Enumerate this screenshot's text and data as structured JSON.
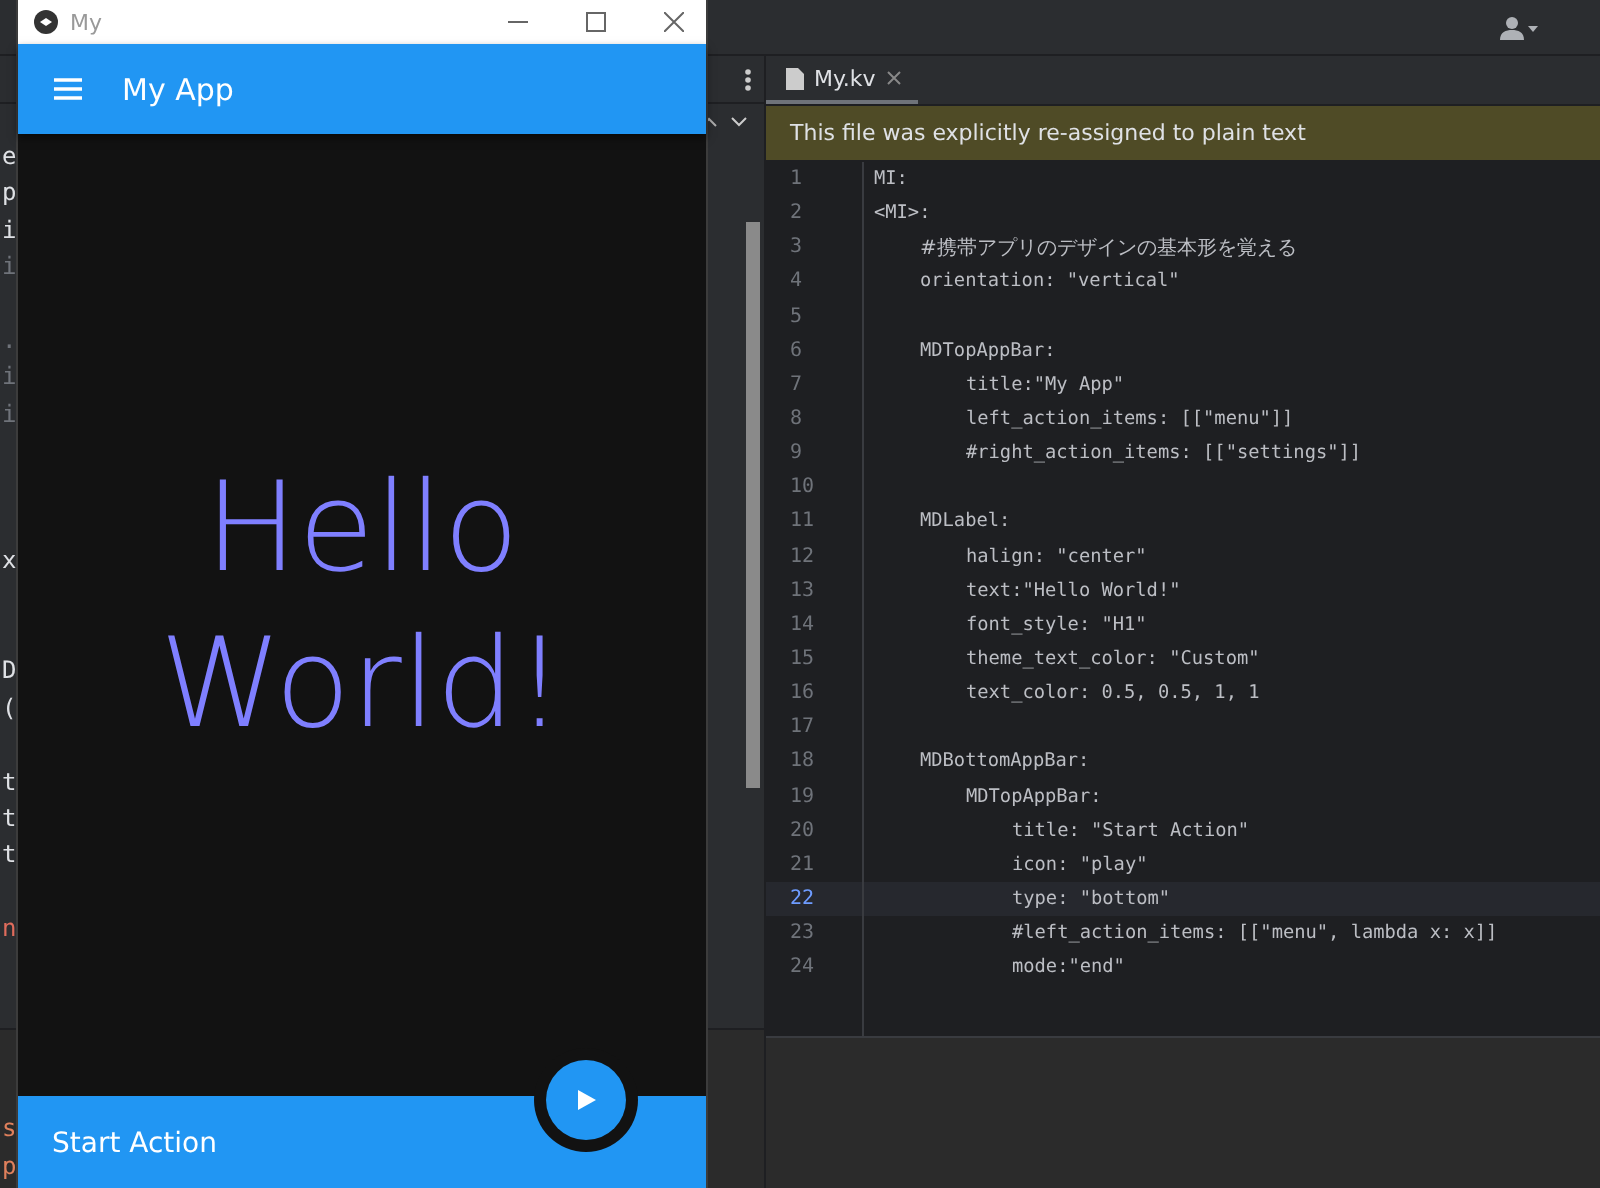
{
  "ide": {
    "tab": {
      "label": "My.kv",
      "selected": true
    },
    "banner": "This file was explicitly re-assigned to plain text",
    "lines": [
      {
        "number": "1",
        "text": "MI:",
        "current": false
      },
      {
        "number": "2",
        "text": "<MI>:",
        "current": false,
        "children": [
          {
            "number": "3",
            "text": "#携帯アプリのデザインの基本形を覚える",
            "current": false
          },
          {
            "number": "4",
            "text": "orientation: \"vertical\"",
            "current": false
          },
          {
            "number": "5",
            "current": false
          },
          {
            "number": "6",
            "text": "MDTopAppBar:",
            "current": false,
            "children": [
              {
                "number": "7",
                "text": "title:\"My App\"",
                "current": false
              },
              {
                "number": "8",
                "text": "left_action_items: [[\"menu\"]]",
                "current": false
              },
              {
                "number": "9",
                "text": "#right_action_items: [[\"settings\"]]",
                "current": false
              }
            ]
          },
          {
            "number": "10",
            "current": false
          },
          {
            "number": "11",
            "text": "MDLabel:",
            "current": false,
            "children": [
              {
                "number": "12",
                "text": "halign: \"center\"",
                "current": false
              },
              {
                "number": "13",
                "text": "text:\"Hello World!\"",
                "current": false
              },
              {
                "number": "14",
                "text": "font_style: \"H1\"",
                "current": false
              },
              {
                "number": "15",
                "text": "theme_text_color: \"Custom\"",
                "current": false
              },
              {
                "number": "16",
                "text": "text_color: 0.5, 0.5, 1, 1",
                "current": false
              }
            ]
          },
          {
            "number": "17",
            "current": false
          },
          {
            "number": "18",
            "text": "MDBottomAppBar:",
            "current": false,
            "children": [
              {
                "number": "19",
                "text": "MDTopAppBar:",
                "current": false,
                "children": [
                  {
                    "number": "20",
                    "text": "title: \"Start Action\"",
                    "current": false
                  },
                  {
                    "number": "21",
                    "text": "icon: \"play\"",
                    "current": false
                  },
                  {
                    "number": "22",
                    "text": "type: \"bottom\"",
                    "current": true
                  },
                  {
                    "number": "23",
                    "text": "#left_action_items: [[\"menu\", lambda x: x]]",
                    "current": false
                  },
                  {
                    "number": "24",
                    "text": "mode:\"end\"",
                    "current": false
                  }
                ]
              }
            ]
          }
        ]
      }
    ],
    "side_fragments": [
      {
        "text": "e",
        "color": "#dfe1e5"
      },
      {
        "text": "p",
        "color": "#dfe1e5"
      },
      {
        "text": "i",
        "color": "#dfe1e5"
      },
      {
        "text": "i",
        "color": "#6f737a"
      },
      {
        "text": ".",
        "color": "#6f737a"
      },
      {
        "text": "i",
        "color": "#6f737a"
      },
      {
        "text": "i",
        "color": "#6f737a"
      },
      {
        "text": "x",
        "color": "#dfe1e5"
      },
      {
        "text": "D",
        "color": "#dfe1e5"
      },
      {
        "text": "(",
        "color": "#dfe1e5"
      },
      {
        "text": "t",
        "color": "#dfe1e5"
      },
      {
        "text": "t",
        "color": "#dfe1e5"
      },
      {
        "text": "t",
        "color": "#dfe1e5"
      },
      {
        "text": "n",
        "color": "#e06c5c"
      }
    ],
    "console_fragments": [
      {
        "text": "s",
        "color": "#e0805c"
      },
      {
        "text": "p",
        "color": "#e0805c"
      }
    ]
  },
  "app": {
    "title": "My",
    "top_bar": {
      "title": "My App"
    },
    "label": "Hello World!",
    "bottom_bar": {
      "title": "Start Action"
    }
  }
}
